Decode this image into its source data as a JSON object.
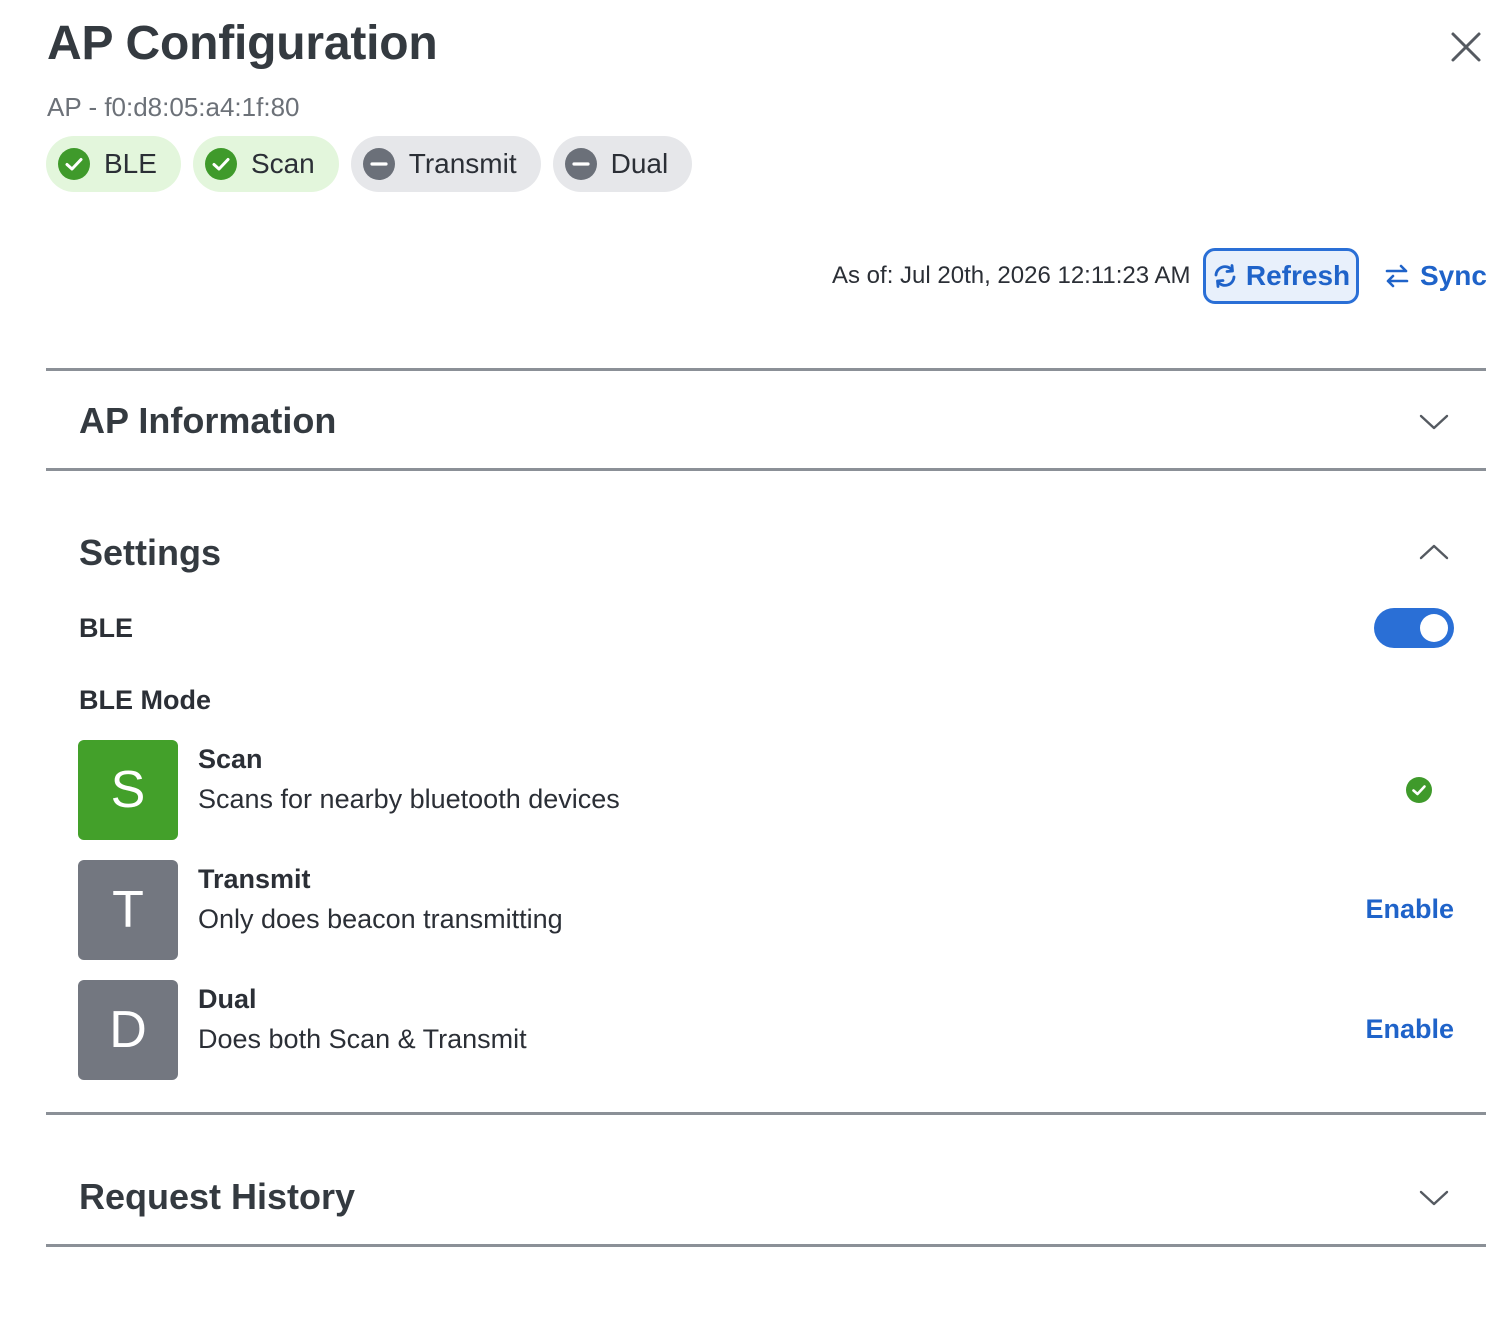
{
  "header": {
    "title": "AP Configuration",
    "subtitle": "AP - f0:d8:05:a4:1f:80"
  },
  "status_chips": [
    {
      "label": "BLE",
      "state": "enabled",
      "icon": "check-circle-icon"
    },
    {
      "label": "Scan",
      "state": "enabled",
      "icon": "check-circle-icon"
    },
    {
      "label": "Transmit",
      "state": "disabled",
      "icon": "minus-circle-icon"
    },
    {
      "label": "Dual",
      "state": "disabled",
      "icon": "minus-circle-icon"
    }
  ],
  "toolbar": {
    "as_of": "As of: Jul 20th, 2026 12:11:23 AM",
    "refresh_label": "Refresh",
    "sync_label": "Sync"
  },
  "sections": {
    "ap_information": {
      "title": "AP Information",
      "expanded": false
    },
    "settings": {
      "title": "Settings",
      "expanded": true
    },
    "request_history": {
      "title": "Request History",
      "expanded": false
    }
  },
  "settings": {
    "ble_label": "BLE",
    "ble_enabled": true,
    "ble_mode_label": "BLE Mode",
    "modes": [
      {
        "letter": "S",
        "name": "Scan",
        "description": "Scans for nearby bluetooth devices",
        "active": true,
        "color": "#43a02a"
      },
      {
        "letter": "T",
        "name": "Transmit",
        "description": "Only does beacon transmitting",
        "active": false,
        "action": "Enable",
        "color": "#737780"
      },
      {
        "letter": "D",
        "name": "Dual",
        "description": "Does both Scan & Transmit",
        "active": false,
        "action": "Enable",
        "color": "#737780"
      }
    ]
  },
  "colors": {
    "accent": "#2a6fd6",
    "success": "#3f9a2b",
    "success_bg": "#e3f6dc",
    "neutral_bg": "#e6e7ea",
    "neutral_icon": "#6b7079"
  }
}
